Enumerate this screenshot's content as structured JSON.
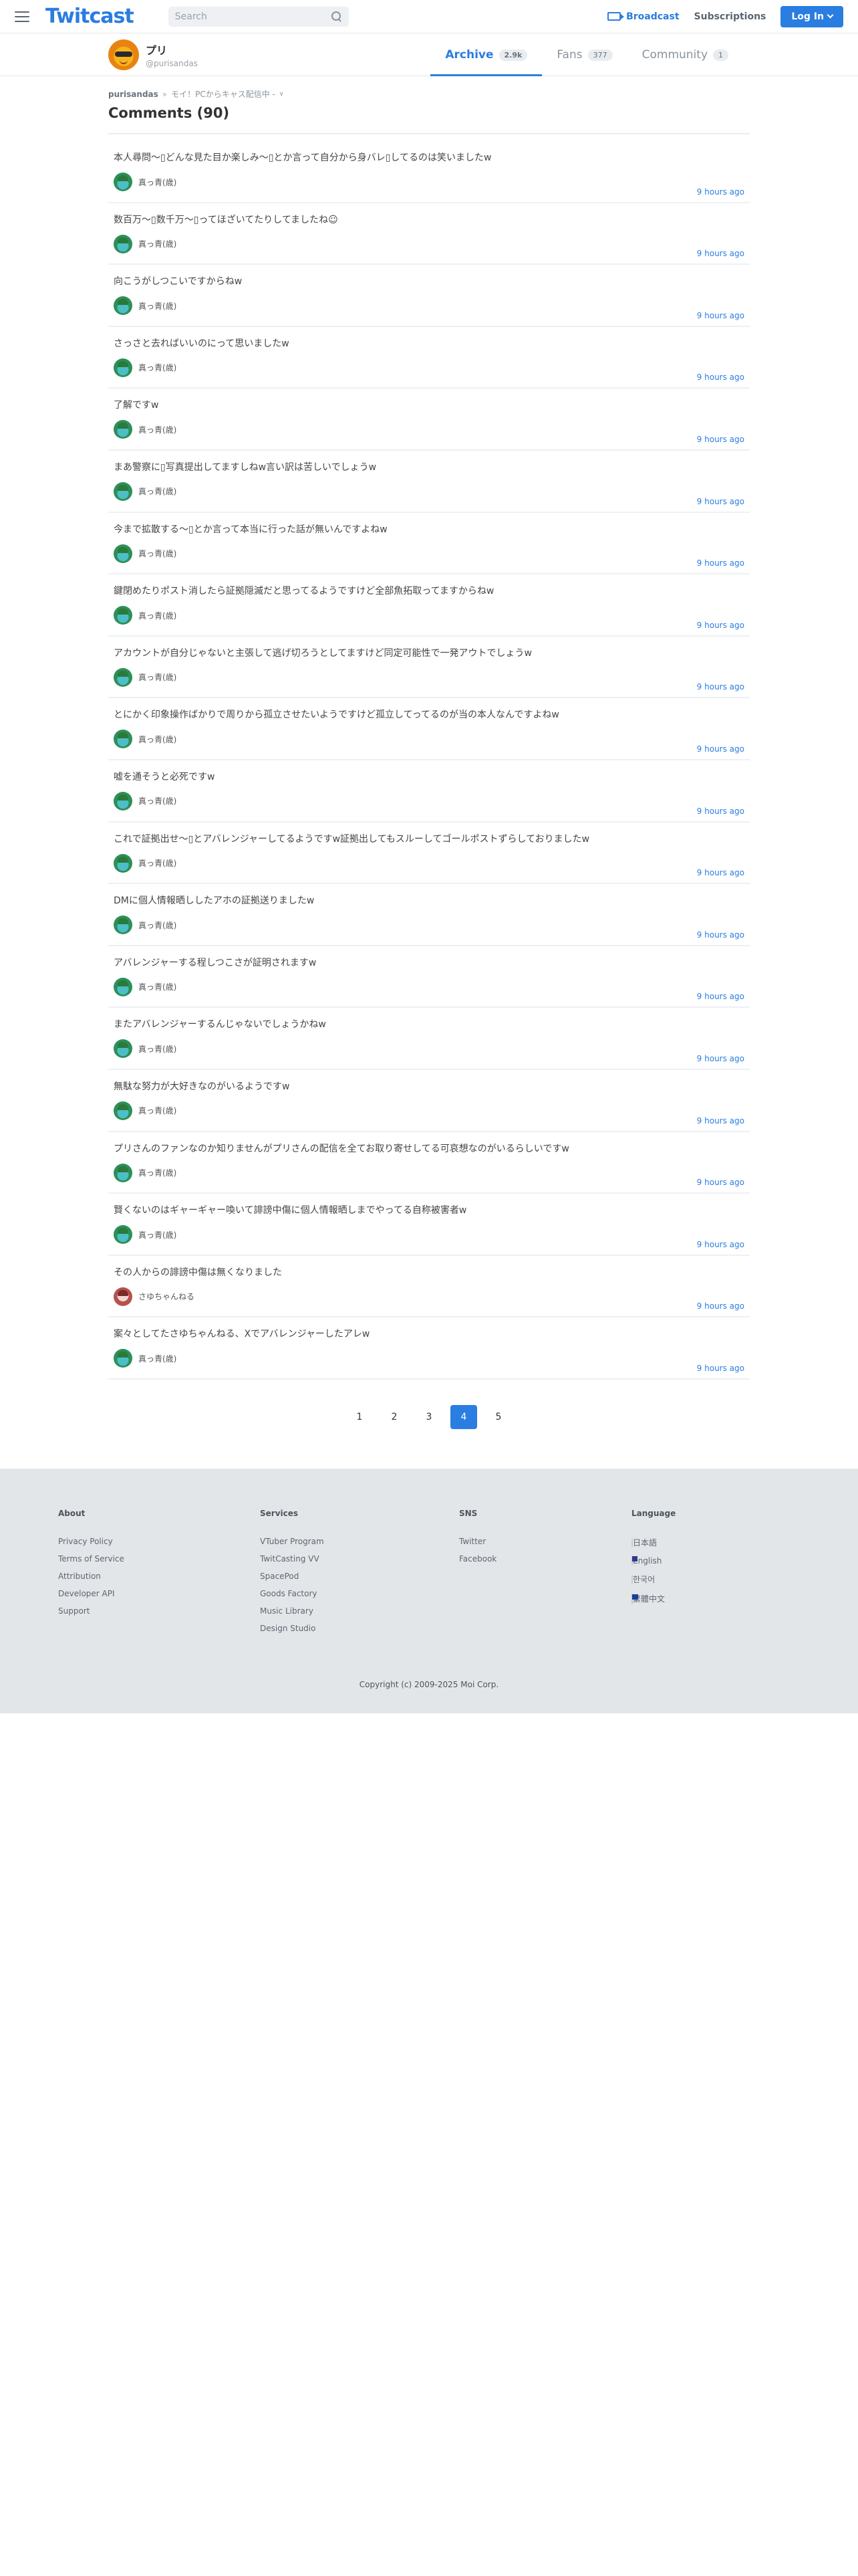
{
  "header": {
    "logo": "Twitcast",
    "search_placeholder": "Search",
    "broadcast": "Broadcast",
    "subscriptions": "Subscriptions",
    "login": "Log In"
  },
  "profile": {
    "name": "プリ",
    "handle": "@purisandas",
    "tabs": [
      {
        "label": "Archive",
        "count": "2.9k"
      },
      {
        "label": "Fans",
        "count": "377"
      },
      {
        "label": "Community",
        "count": "1"
      }
    ]
  },
  "breadcrumb": {
    "user": "purisandas",
    "sep": "»",
    "live": "モイ！PCからキャス配信中 -",
    "dropdown": "∨"
  },
  "comments_title": "Comments (90)",
  "comments": [
    {
      "text": "本人尋問〜▯どんな見た目か楽しみ〜▯とか言って自分から身バレ▯してるのは笑いましたw",
      "user": "真っ青(歳)",
      "time": "9 hours ago",
      "avatar": "user-avatar"
    },
    {
      "text": "数百万〜▯数千万〜▯ってほざいてたりしてましたね☺",
      "user": "真っ青(歳)",
      "time": "9 hours ago",
      "avatar": "user-avatar"
    },
    {
      "text": "向こうがしつこいですからねw",
      "user": "真っ青(歳)",
      "time": "9 hours ago",
      "avatar": "user-avatar"
    },
    {
      "text": "さっさと去ればいいのにって思いましたw",
      "user": "真っ青(歳)",
      "time": "9 hours ago",
      "avatar": "user-avatar"
    },
    {
      "text": "了解ですw",
      "user": "真っ青(歳)",
      "time": "9 hours ago",
      "avatar": "user-avatar"
    },
    {
      "text": "まあ警察に▯写真提出してますしねw言い訳は苦しいでしょうw",
      "user": "真っ青(歳)",
      "time": "9 hours ago",
      "avatar": "user-avatar"
    },
    {
      "text": "今まで拡散する〜▯とか言って本当に行った話が無いんですよねw",
      "user": "真っ青(歳)",
      "time": "9 hours ago",
      "avatar": "user-avatar"
    },
    {
      "text": "鍵閉めたりポスト消したら証拠隠滅だと思ってるようですけど全部魚拓取ってますからねw",
      "user": "真っ青(歳)",
      "time": "9 hours ago",
      "avatar": "user-avatar"
    },
    {
      "text": "アカウントが自分じゃないと主張して逃げ切ろうとしてますけど同定可能性で一発アウトでしょうw",
      "user": "真っ青(歳)",
      "time": "9 hours ago",
      "avatar": "user-avatar"
    },
    {
      "text": "とにかく印象操作ばかりで周りから孤立させたいようですけど孤立してってるのが当の本人なんですよねw",
      "user": "真っ青(歳)",
      "time": "9 hours ago",
      "avatar": "user-avatar"
    },
    {
      "text": "嘘を通そうと必死ですw",
      "user": "真っ青(歳)",
      "time": "9 hours ago",
      "avatar": "user-avatar"
    },
    {
      "text": "これで証拠出せ〜▯とアバレンジャーしてるようですw証拠出してもスルーしてゴールポストずらしておりましたw",
      "user": "真っ青(歳)",
      "time": "9 hours ago",
      "avatar": "user-avatar"
    },
    {
      "text": "DMに個人情報晒ししたアホの証拠送りましたw",
      "user": "真っ青(歳)",
      "time": "9 hours ago",
      "avatar": "user-avatar"
    },
    {
      "text": "アバレンジャーする程しつこさが証明されますw",
      "user": "真っ青(歳)",
      "time": "9 hours ago",
      "avatar": "user-avatar"
    },
    {
      "text": "またアバレンジャーするんじゃないでしょうかねw",
      "user": "真っ青(歳)",
      "time": "9 hours ago",
      "avatar": "user-avatar"
    },
    {
      "text": "無駄な努力が大好きなのがいるようですw",
      "user": "真っ青(歳)",
      "time": "9 hours ago",
      "avatar": "user-avatar"
    },
    {
      "text": "プリさんのファンなのか知りませんがプリさんの配信を全てお取り寄せしてる可哀想なのがいるらしいですw",
      "user": "真っ青(歳)",
      "time": "9 hours ago",
      "avatar": "user-avatar"
    },
    {
      "text": "賢くないのはギャーギャー喚いて誹謗中傷に個人情報晒しまでやってる自称被害者w",
      "user": "真っ青(歳)",
      "time": "9 hours ago",
      "avatar": "user-avatar"
    },
    {
      "text": "その人からの誹謗中傷は無くなりました",
      "user": "さゆちゃんねる",
      "time": "9 hours ago",
      "avatar": "user-avatar-alt"
    },
    {
      "text": "案々としてたさゆちゃんねる、Xでアバレンジャーしたアレw",
      "user": "真っ青(歳)",
      "time": "9 hours ago",
      "avatar": "user-avatar"
    }
  ],
  "pagination": {
    "pages": [
      "1",
      "2",
      "3",
      "4",
      "5"
    ],
    "current": "4"
  },
  "footer": {
    "about": {
      "title": "About",
      "links": [
        "Privacy Policy",
        "Terms of Service",
        "Attribution",
        "Developer API",
        "Support"
      ]
    },
    "services": {
      "title": "Services",
      "links": [
        "VTuber Program",
        "TwitCasting VV",
        "SpacePod",
        "Goods Factory",
        "Music Library",
        "Design Studio"
      ]
    },
    "sns": {
      "title": "SNS",
      "links": [
        "Twitter",
        "Facebook"
      ]
    },
    "language": {
      "title": "Language",
      "links": [
        "日本語",
        "English",
        "한국어",
        "繁體中文"
      ]
    },
    "copyright": "Copyright (c) 2009-2025 Moi Corp."
  },
  "colors": {
    "accent": "#2a7de1",
    "footer_bg": "#e3e6e9"
  }
}
